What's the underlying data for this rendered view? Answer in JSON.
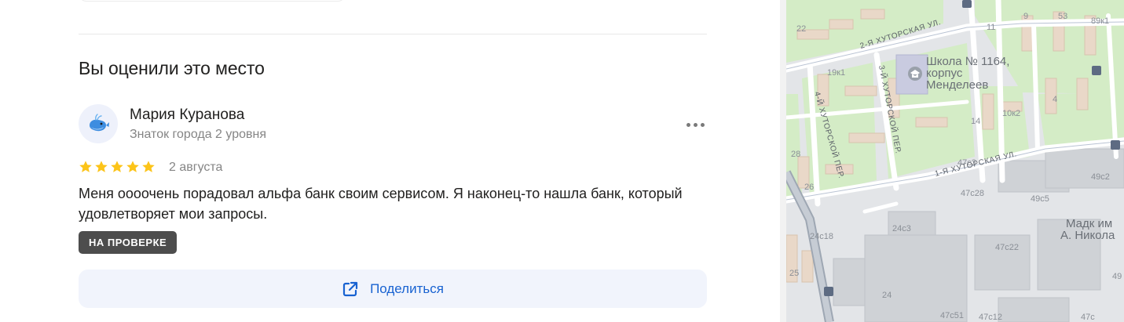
{
  "review_section": {
    "title": "Вы оценили это место",
    "author": {
      "name": "Мария Куранова",
      "level": "Знаток города 2 уровня",
      "avatar_icon": "whale-icon"
    },
    "rating": 5,
    "date": "2 августа",
    "text": "Меня оооочень порадовал альфа банк своим сервисом. Я наконец-то нашла банк, который удовлетворяет мои запросы.",
    "status_badge": "НА ПРОВЕРКЕ",
    "share_label": "Поделиться",
    "more_icon": "more-dots-icon",
    "colors": {
      "star": "#fcc419",
      "accent": "#1862d1",
      "badge_bg": "#4d4d4d",
      "share_bg": "#f1f4fc"
    }
  },
  "map": {
    "streets": {
      "street_2": "2-Я ХУТОРСКАЯ УЛ.",
      "street_3": "3-Й ХУТОРСКОЙ ПЕР.",
      "street_4": "4-Й ХУТОРСКОЙ ПЕР.",
      "street_1": "1-Я ХУТОРСКАЯ УЛ."
    },
    "poi": {
      "line1": "Школа № 1164,",
      "line2": "корпус",
      "line3": "Менделеев",
      "icon": "school-icon"
    },
    "poi_right": {
      "line1": "Мадк им",
      "line2": "А. Никола"
    },
    "houses": {
      "h22": "22",
      "h9": "9",
      "h53": "53",
      "h89k1": "89к1",
      "h11": "11",
      "h19k1": "19к1",
      "h4": "4",
      "h14": "14",
      "h10k2": "10к2",
      "h28": "28",
      "h26": "26",
      "h47c3": "47с3",
      "h49c2": "49с2",
      "h47c28": "47с28",
      "h49c5": "49с5",
      "h24c3": "24с3",
      "h24c18": "24с18",
      "h47c22": "47с22",
      "h25": "25",
      "h49": "49",
      "h24": "24",
      "h47c51": "47с51",
      "h47c12": "47с12",
      "h47c": "47с"
    },
    "metro_icon": "metro-icon"
  }
}
